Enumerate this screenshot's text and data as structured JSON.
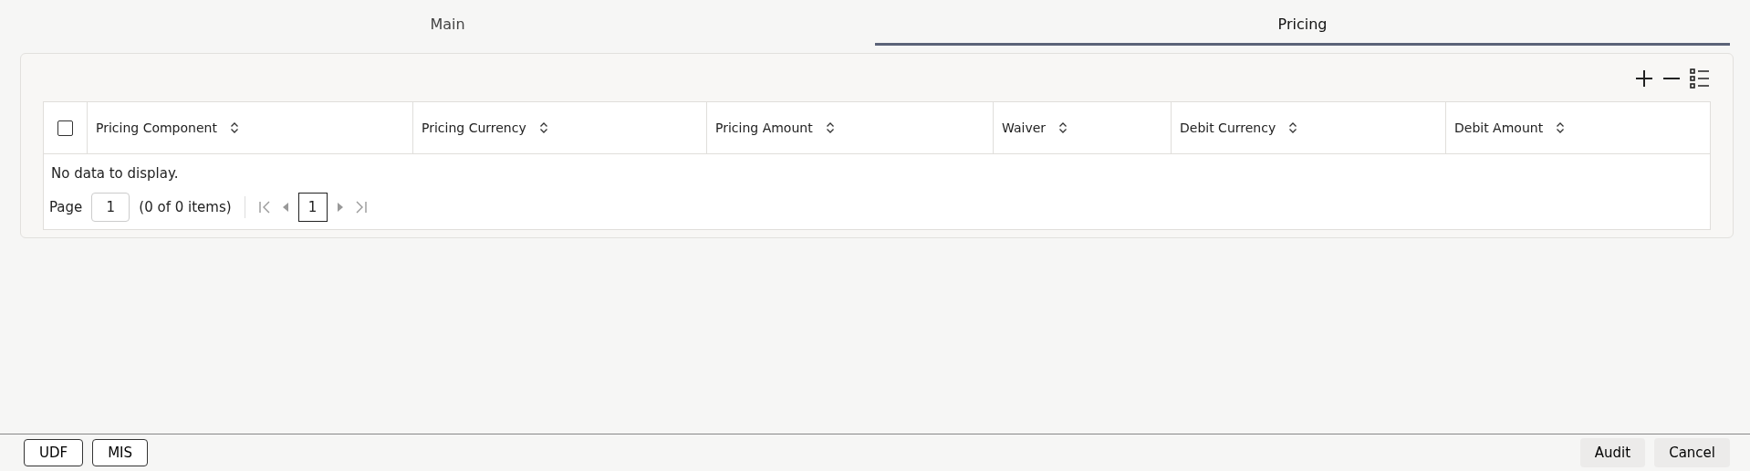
{
  "tabs": [
    {
      "label": "Main",
      "selected": false
    },
    {
      "label": "Pricing",
      "selected": true
    }
  ],
  "table": {
    "select_all": {
      "checked": false
    },
    "columns": [
      {
        "label": "Pricing Component"
      },
      {
        "label": "Pricing Currency"
      },
      {
        "label": "Pricing Amount"
      },
      {
        "label": "Waiver"
      },
      {
        "label": "Debit Currency"
      },
      {
        "label": "Debit Amount"
      }
    ],
    "empty_message": "No data to display.",
    "pagination": {
      "page_label": "Page",
      "page_value": "1",
      "items": "(0 of 0 items)",
      "current_page": "1"
    }
  },
  "footer": {
    "left_buttons": [
      "UDF",
      "MIS"
    ],
    "right_buttons": [
      "Audit",
      "Cancel"
    ]
  }
}
